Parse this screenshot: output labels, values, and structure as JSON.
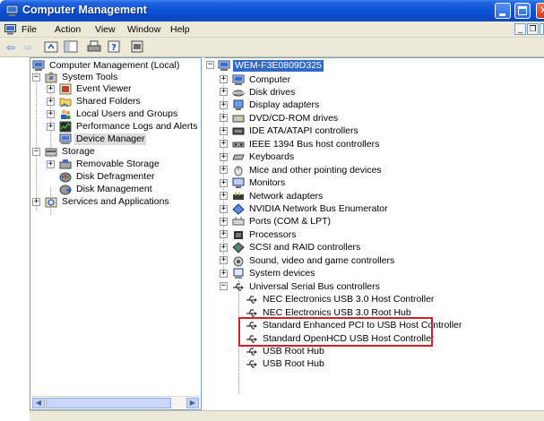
{
  "window": {
    "title": "Computer Management"
  },
  "menubar": {
    "items": [
      "File",
      "Action",
      "View",
      "Window",
      "Help"
    ]
  },
  "left_tree": [
    {
      "label": "Computer Management (Local)",
      "icon": "computer-management-icon",
      "level": 0,
      "expander": "minus"
    },
    {
      "label": "System Tools",
      "icon": "system-tools-icon",
      "level": 1,
      "expander": "minus"
    },
    {
      "label": "Event Viewer",
      "icon": "event-viewer-icon",
      "level": 2,
      "expander": "plus"
    },
    {
      "label": "Shared Folders",
      "icon": "shared-folders-icon",
      "level": 2,
      "expander": "plus"
    },
    {
      "label": "Local Users and Groups",
      "icon": "users-groups-icon",
      "level": 2,
      "expander": "plus"
    },
    {
      "label": "Performance Logs and Alerts",
      "icon": "performance-logs-icon",
      "level": 2,
      "expander": "plus"
    },
    {
      "label": "Device Manager",
      "icon": "device-manager-icon",
      "level": 2,
      "expander": "none",
      "state": "hover"
    },
    {
      "label": "Storage",
      "icon": "storage-icon",
      "level": 1,
      "expander": "minus"
    },
    {
      "label": "Removable Storage",
      "icon": "removable-storage-icon",
      "level": 2,
      "expander": "plus"
    },
    {
      "label": "Disk Defragmenter",
      "icon": "disk-defragmenter-icon",
      "level": 2,
      "expander": "none"
    },
    {
      "label": "Disk Management",
      "icon": "disk-management-icon",
      "level": 2,
      "expander": "none"
    },
    {
      "label": "Services and Applications",
      "icon": "services-applications-icon",
      "level": 1,
      "expander": "plus"
    }
  ],
  "device_tree": {
    "root": {
      "label": "WEM-F3E0809D325",
      "icon": "computer-icon"
    },
    "categories": [
      {
        "label": "Computer",
        "icon": "computer-icon",
        "expander": "plus"
      },
      {
        "label": "Disk drives",
        "icon": "disk-drive-icon",
        "expander": "plus"
      },
      {
        "label": "Display adapters",
        "icon": "display-adapter-icon",
        "expander": "plus"
      },
      {
        "label": "DVD/CD-ROM drives",
        "icon": "dvd-drive-icon",
        "expander": "plus"
      },
      {
        "label": "IDE ATA/ATAPI controllers",
        "icon": "ide-controller-icon",
        "expander": "plus"
      },
      {
        "label": "IEEE 1394 Bus host controllers",
        "icon": "ieee1394-icon",
        "expander": "plus"
      },
      {
        "label": "Keyboards",
        "icon": "keyboard-icon",
        "expander": "plus"
      },
      {
        "label": "Mice and other pointing devices",
        "icon": "mouse-icon",
        "expander": "plus"
      },
      {
        "label": "Monitors",
        "icon": "monitor-icon",
        "expander": "plus"
      },
      {
        "label": "Network adapters",
        "icon": "network-adapter-icon",
        "expander": "plus"
      },
      {
        "label": "NVIDIA Network Bus Enumerator",
        "icon": "bus-enumerator-icon",
        "expander": "plus"
      },
      {
        "label": "Ports (COM & LPT)",
        "icon": "ports-icon",
        "expander": "plus"
      },
      {
        "label": "Processors",
        "icon": "processor-icon",
        "expander": "plus"
      },
      {
        "label": "SCSI and RAID controllers",
        "icon": "scsi-icon",
        "expander": "plus"
      },
      {
        "label": "Sound, video and game controllers",
        "icon": "sound-icon",
        "expander": "plus"
      },
      {
        "label": "System devices",
        "icon": "system-devices-icon",
        "expander": "plus"
      },
      {
        "label": "Universal Serial Bus controllers",
        "icon": "usb-icon",
        "expander": "minus"
      }
    ],
    "usb_children": [
      {
        "label": "NEC Electronics USB 3.0 Host Controller",
        "icon": "usb-icon",
        "highlighted": true
      },
      {
        "label": "NEC Electronics USB 3.0 Root Hub",
        "icon": "usb-icon",
        "highlighted": true
      },
      {
        "label": "Standard Enhanced PCI to USB Host Controller",
        "icon": "usb-icon"
      },
      {
        "label": "Standard OpenHCD USB Host Controller",
        "icon": "usb-icon"
      },
      {
        "label": "USB Root Hub",
        "icon": "usb-icon"
      },
      {
        "label": "USB Root Hub",
        "icon": "usb-icon"
      }
    ]
  },
  "colors": {
    "titlebar": "#0a54d8",
    "selection": "#316ac5",
    "highlight_box": "#d0202a",
    "chrome": "#ece9d8"
  }
}
